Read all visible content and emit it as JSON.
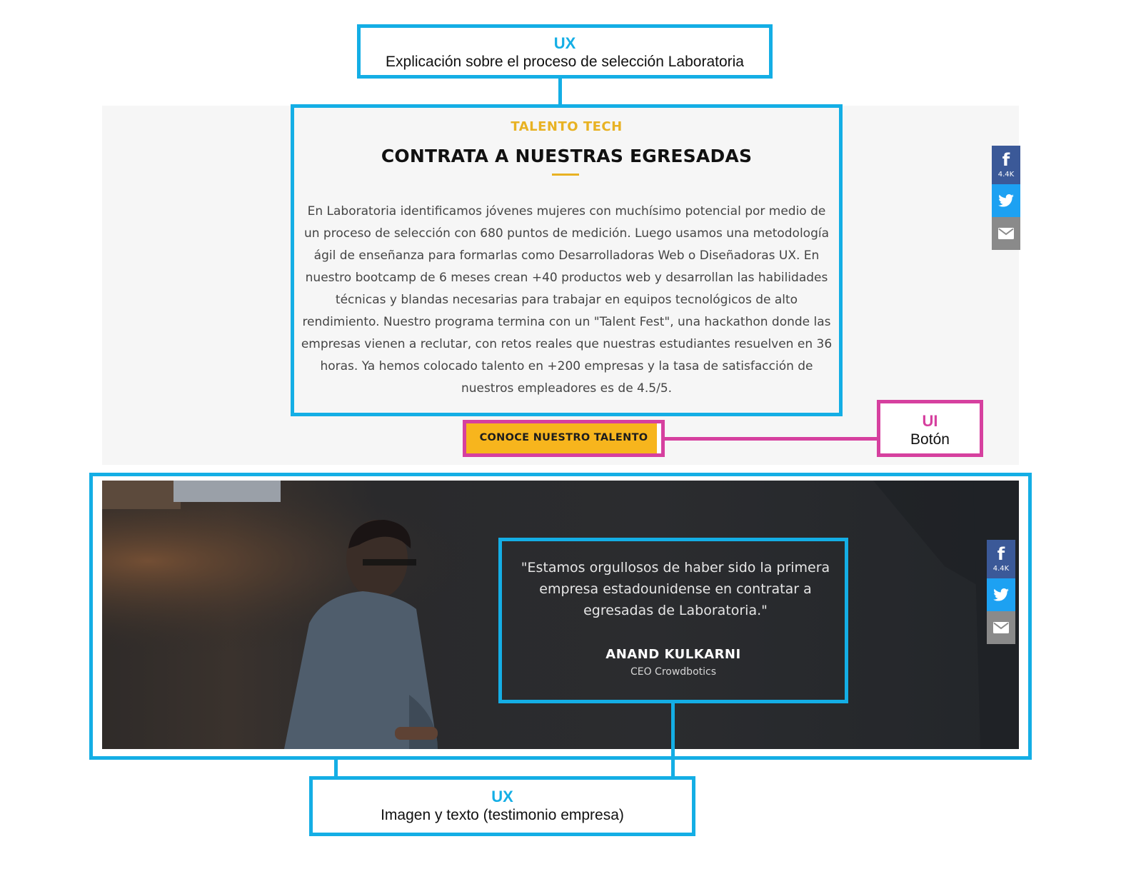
{
  "annotations": {
    "top": {
      "tag": "UX",
      "desc": "Explicación sobre el proceso de selección Laboratoria"
    },
    "button": {
      "tag": "UI",
      "desc": "Botón"
    },
    "bottom": {
      "tag": "UX",
      "desc": "Imagen y texto (testimonio empresa)"
    }
  },
  "talent_section": {
    "eyebrow": "TALENTO TECH",
    "title": "CONTRATA A NUESTRAS EGRESADAS",
    "body": "En Laboratoria identificamos jóvenes mujeres con muchísimo potencial por medio de un proceso de selección con 680 puntos de medición. Luego usamos una metodología ágil de enseñanza para formarlas como Desarrolladoras Web o Diseñadoras UX. En nuestro bootcamp de 6 meses crean +40 productos web y desarrollan las habilidades técnicas y blandas necesarias para trabajar en equipos tecnológicos de alto rendimiento. Nuestro programa termina con un \"Talent Fest\", una hackathon donde las empresas vienen a reclutar, con retos reales que nuestras estudiantes resuelven en 36 horas. Ya hemos colocado talento en +200 empresas y la tasa de satisfacción de nuestros empleadores es de 4.5/5.",
    "cta_label": "CONOCE NUESTRO TALENTO"
  },
  "share": {
    "facebook_glyph": "f",
    "facebook_count": "4.4K"
  },
  "testimonial": {
    "quote": "\"Estamos orgullosos de haber sido la primera empresa estadounidense en contratar a egresadas de Laboratoria.\"",
    "name": "ANAND KULKARNI",
    "role": "CEO Crowdbotics"
  },
  "colors": {
    "ux_annotation": "#14aee5",
    "ui_annotation": "#d6409f",
    "accent_yellow": "#f7b51d",
    "facebook": "#3b5998",
    "twitter": "#1da1f2",
    "email": "#8a8a8a"
  }
}
